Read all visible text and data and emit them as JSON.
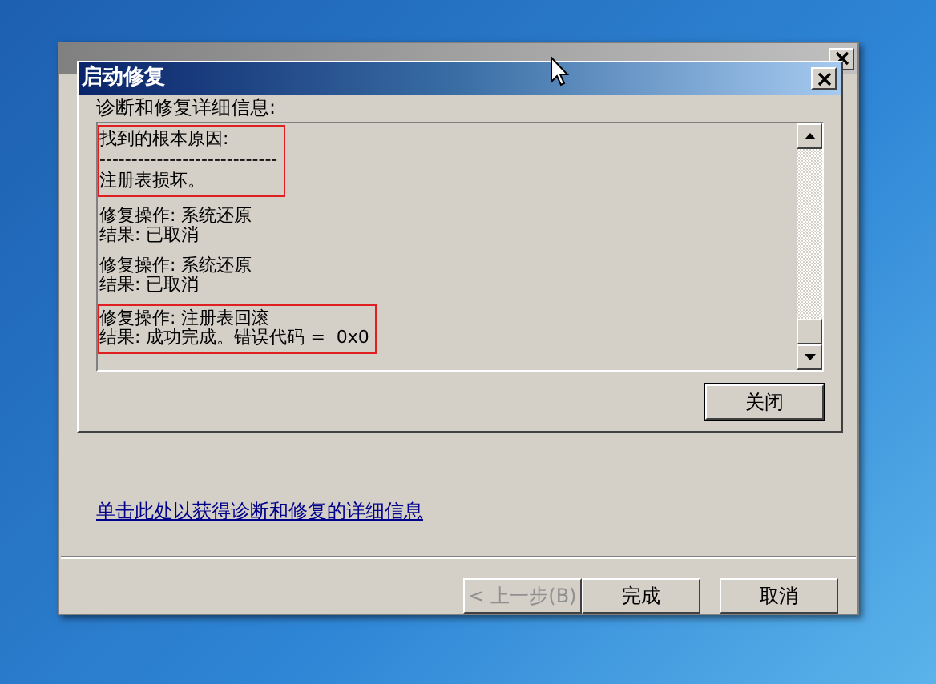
{
  "back_window": {
    "link": "单击此处以获得诊断和修复的详细信息",
    "buttons": [
      {
        "label": "< 上一步(B)",
        "disabled": true
      },
      {
        "label": "完成",
        "disabled": false
      },
      {
        "label": "取消",
        "disabled": false
      }
    ]
  },
  "dialog": {
    "title": "启动修复",
    "label": "诊断和修复详细信息:",
    "entries": [
      {
        "lines": [
          "找到的根本原因:",
          "----------------------------",
          "注册表损坏。"
        ],
        "highlighted": true
      },
      {
        "lines": [
          "修复操作: 系统还原",
          "结果: 已取消"
        ],
        "highlighted": false
      },
      {
        "lines": [
          "修复操作: 系统还原",
          "结果: 已取消"
        ],
        "highlighted": false
      },
      {
        "lines": [
          "修复操作: 注册表回滚",
          "结果: 成功完成。错误代码 =  0x0"
        ],
        "highlighted": true
      }
    ],
    "close_button": "关闭"
  }
}
